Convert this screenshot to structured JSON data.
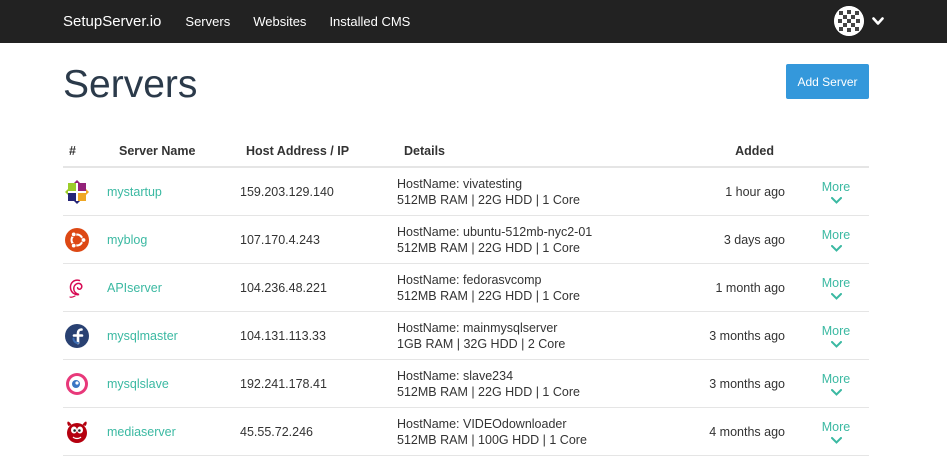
{
  "nav": {
    "brand": "SetupServer.io",
    "items": [
      "Servers",
      "Websites",
      "Installed CMS"
    ]
  },
  "page": {
    "title": "Servers",
    "add_button": "Add Server"
  },
  "table": {
    "headers": {
      "num": "#",
      "name": "Server Name",
      "host": "Host Address / IP",
      "details": "Details",
      "added": "Added"
    },
    "rows": [
      {
        "icon": "centos-icon",
        "name": "mystartup",
        "ip": "159.203.129.140",
        "hostname": "HostName: vivatesting",
        "specs": "512MB RAM | 22G HDD | 1 Core",
        "added": "1 hour ago",
        "more": "More"
      },
      {
        "icon": "ubuntu-icon",
        "name": "myblog",
        "ip": "107.170.4.243",
        "hostname": "HostName: ubuntu-512mb-nyc2-01",
        "specs": "512MB RAM | 22G HDD | 1 Core",
        "added": "3 days ago",
        "more": "More"
      },
      {
        "icon": "debian-icon",
        "name": "APIserver",
        "ip": "104.236.48.221",
        "hostname": "HostName: fedorasvcomp",
        "specs": "512MB RAM | 22G HDD | 1 Core",
        "added": "1 month ago",
        "more": "More"
      },
      {
        "icon": "fedora-icon",
        "name": "mysqlmaster",
        "ip": "104.131.113.33",
        "hostname": "HostName: mainmysqlserver",
        "specs": "1GB RAM | 32G HDD | 2 Core",
        "added": "3 months ago",
        "more": "More"
      },
      {
        "icon": "opensuse-icon",
        "name": "mysqlslave",
        "ip": "192.241.178.41",
        "hostname": "HostName: slave234",
        "specs": "512MB RAM | 22G HDD | 1 Core",
        "added": "3 months ago",
        "more": "More"
      },
      {
        "icon": "freebsd-icon",
        "name": "mediaserver",
        "ip": "45.55.72.246",
        "hostname": "HostName: VIDEOdownloader",
        "specs": "512MB RAM | 100G HDD | 1 Core",
        "added": "4 months ago",
        "more": "More"
      }
    ]
  },
  "colors": {
    "navbar": "#222222",
    "accent_link": "#3bb9a2",
    "button": "#3498db",
    "title": "#2b3a4a"
  }
}
